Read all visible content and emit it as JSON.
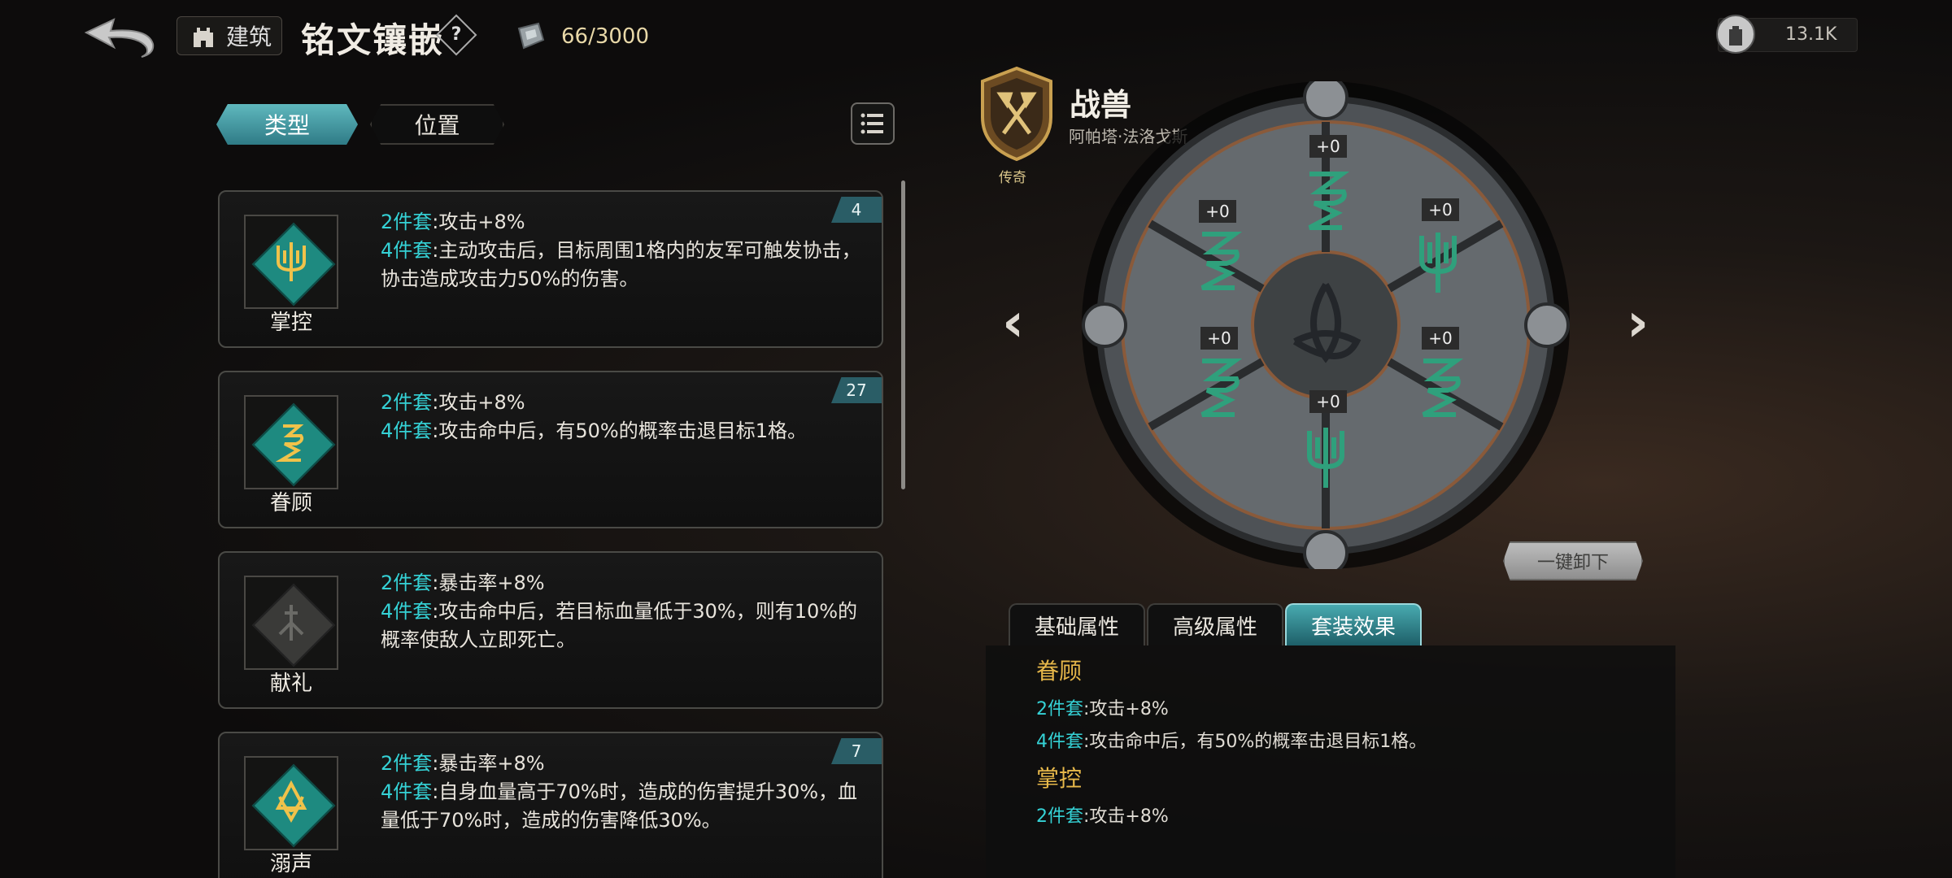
{
  "topbar": {
    "building_label": "建筑",
    "title": "铭文镶嵌",
    "help_symbol": "?",
    "resource_value": "66/3000",
    "power_value": "13.1K"
  },
  "filter_tabs": [
    {
      "label": "类型",
      "active": true
    },
    {
      "label": "位置",
      "active": false
    }
  ],
  "rune_sets": [
    {
      "name": "掌控",
      "count": "4",
      "line1_key": "2件套",
      "line1_val": ":攻击+8%",
      "line2_key": "4件套",
      "line2_val": ":主动攻击后，目标周围1格内的友军可触发协击，协击造成攻击力50%的伤害。",
      "icon": "trident-icon"
    },
    {
      "name": "眷顾",
      "count": "27",
      "line1_key": "2件套",
      "line1_val": ":攻击+8%",
      "line2_key": "4件套",
      "line2_val": ":攻击命中后，有50%的概率击退目标1格。",
      "icon": "serpent-rune-icon"
    },
    {
      "name": "献礼",
      "count": "",
      "line1_key": "2件套",
      "line1_val": ":暴击率+8%",
      "line2_key": "4件套",
      "line2_val": ":攻击命中后，若目标血量低于30%，则有10%的概率使敌人立即死亡。",
      "icon": "offering-rune-icon"
    },
    {
      "name": "溺声",
      "count": "7",
      "line1_key": "2件套",
      "line1_val": ":暴击率+8%",
      "line2_key": "4件套",
      "line2_val": ":自身血量高于70%时，造成的伤害提升30%，血量低于70%时，造成的伤害降低30%。",
      "icon": "drowning-rune-icon"
    }
  ],
  "hero": {
    "name": "战兽",
    "subtitle": "阿帕塔·法洛戈斯",
    "rarity": "传奇"
  },
  "wheel": {
    "slots": [
      "+0",
      "+0",
      "+0",
      "+0",
      "+0",
      "+0"
    ],
    "prev_arrow": "‹",
    "next_arrow": "›",
    "unequip_label": "一键卸下"
  },
  "info_tabs": [
    {
      "label": "基础属性",
      "active": false
    },
    {
      "label": "高级属性",
      "active": false
    },
    {
      "label": "套装效果",
      "active": true
    }
  ],
  "set_effects": [
    {
      "name": "眷顾",
      "lines": [
        {
          "key": "2件套",
          "val": ":攻击+8%"
        },
        {
          "key": "4件套",
          "val": ":攻击命中后，有50%的概率击退目标1格。"
        }
      ]
    },
    {
      "name": "掌控",
      "lines": [
        {
          "key": "2件套",
          "val": ":攻击+8%"
        }
      ]
    }
  ],
  "colors": {
    "accent": "#35d2d6",
    "gold": "#e7b84a",
    "rune_teal": "#1e8a80"
  }
}
